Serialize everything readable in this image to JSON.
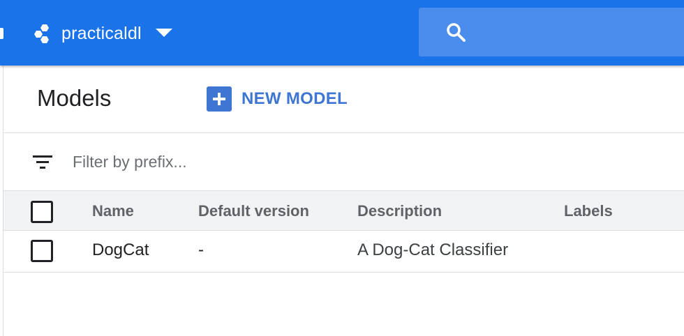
{
  "topbar": {
    "project_name": "practicaldl",
    "project_icon": "hexagon-cluster-icon",
    "search_icon": "search-icon",
    "colors": {
      "bar": "#1a73e8",
      "search_bg": "#4a8ded"
    }
  },
  "page": {
    "title": "Models",
    "new_model_label": "NEW MODEL"
  },
  "filter": {
    "placeholder": "Filter by prefix...",
    "value": ""
  },
  "table": {
    "columns": [
      "Name",
      "Default version",
      "Description",
      "Labels"
    ],
    "rows": [
      {
        "name": "DogCat",
        "default_version": "-",
        "description": "A Dog-Cat Classifier",
        "labels": ""
      }
    ]
  },
  "colors": {
    "accent": "#3f76d3"
  }
}
